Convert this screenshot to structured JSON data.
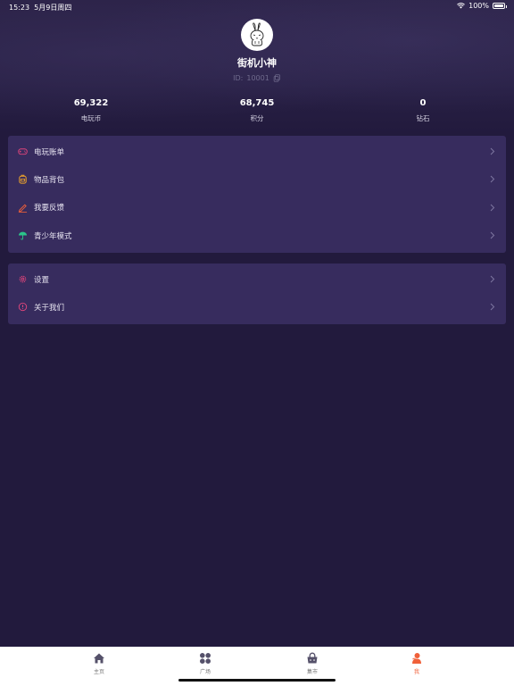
{
  "status_bar": {
    "time": "15:23",
    "date": "5月9日周四",
    "battery": "100%"
  },
  "profile": {
    "name": "街机小神",
    "id_label": "ID:",
    "id_value": "10001"
  },
  "stats": [
    {
      "value": "69,322",
      "label": "电玩币"
    },
    {
      "value": "68,745",
      "label": "积分"
    },
    {
      "value": "0",
      "label": "钻石"
    }
  ],
  "menu_group_1": [
    {
      "label": "电玩账单",
      "icon": "gamepad-icon",
      "color": "#e0457b"
    },
    {
      "label": "物品背包",
      "icon": "backpack-icon",
      "color": "#f0a52a"
    },
    {
      "label": "我要反馈",
      "icon": "pen-icon",
      "color": "#f06039"
    },
    {
      "label": "青少年模式",
      "icon": "umbrella-icon",
      "color": "#2bc48a"
    }
  ],
  "menu_group_2": [
    {
      "label": "设置",
      "icon": "gear-icon",
      "color": "#e0457b"
    },
    {
      "label": "关于我们",
      "icon": "info-icon",
      "color": "#e0457b"
    }
  ],
  "tabs": [
    {
      "label": "主页",
      "icon": "home-icon",
      "active": false
    },
    {
      "label": "广场",
      "icon": "grid-icon",
      "active": false
    },
    {
      "label": "集市",
      "icon": "basket-icon",
      "active": false
    },
    {
      "label": "我",
      "icon": "person-icon",
      "active": true
    }
  ],
  "colors": {
    "background": "#221a3d",
    "card": "#372c5e",
    "accent": "#f06039"
  }
}
